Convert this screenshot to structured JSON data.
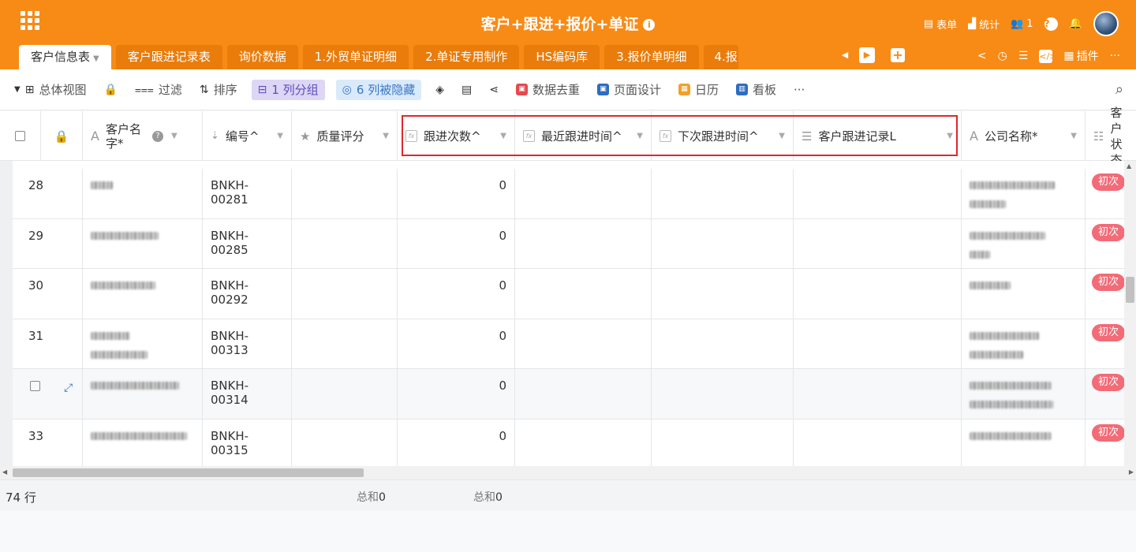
{
  "app": {
    "title": "客户+跟进+报价+单证",
    "info_icon": "i",
    "header_actions": [
      {
        "id": "form",
        "icon": "form-icon",
        "glyph": "▤",
        "label": "表单"
      },
      {
        "id": "stats",
        "icon": "bar-chart-icon",
        "glyph": "▟",
        "label": "统计"
      },
      {
        "id": "members",
        "icon": "users-icon",
        "glyph": "👥",
        "label": "1"
      }
    ],
    "help_glyph": "?",
    "bell_glyph": "🔔"
  },
  "tabs": [
    {
      "label": "客户信息表",
      "active": true
    },
    {
      "label": "客户跟进记录表"
    },
    {
      "label": "询价数据"
    },
    {
      "label": "1.外贸单证明细"
    },
    {
      "label": "2.单证专用制作"
    },
    {
      "label": "HS编码库"
    },
    {
      "label": "3.报价单明细"
    },
    {
      "label": "4.报"
    }
  ],
  "tab_tools": {
    "plugins_label": "插件",
    "more": "···"
  },
  "toolbar": {
    "view_label": "总体视图",
    "filter_label": "过滤",
    "sort_label": "排序",
    "group_label": "1 列分组",
    "hidden_label": "6 列被隐藏",
    "dedupe_label": "数据去重",
    "page_design_label": "页面设计",
    "calendar_label": "日历",
    "kanban_label": "看板",
    "more": "···"
  },
  "columns": {
    "name": "客户名\n字*",
    "code": "编号^",
    "rating": "质量评分",
    "follow_count": "跟进次数^",
    "last_follow": "最近跟进时间^",
    "next_follow": "下次跟进时间^",
    "follow_records": "客户跟进记录L",
    "company": "公司名称*",
    "status": "客户\n状态"
  },
  "rows": [
    {
      "index": "28",
      "code": "BNKH-00281",
      "follow_count": "0",
      "status": "初次"
    },
    {
      "index": "29",
      "code": "BNKH-00285",
      "follow_count": "0",
      "status": "初次"
    },
    {
      "index": "30",
      "code": "BNKH-00292",
      "follow_count": "0",
      "status": "初次"
    },
    {
      "index": "31",
      "code": "BNKH-00313",
      "follow_count": "0",
      "status": "初次"
    },
    {
      "index": "",
      "code": "BNKH-00314",
      "follow_count": "0",
      "status": "初次"
    },
    {
      "index": "33",
      "code": "BNKH-00315",
      "follow_count": "0",
      "status": "初次"
    }
  ],
  "footer": {
    "row_count": "74 行",
    "sum1_label": "总和",
    "sum1_value": "0",
    "sum2_label": "总和",
    "sum2_value": "0"
  },
  "colors": {
    "brand": "#f78b16",
    "status": "#f26b77",
    "highlight": "#e0262f"
  }
}
